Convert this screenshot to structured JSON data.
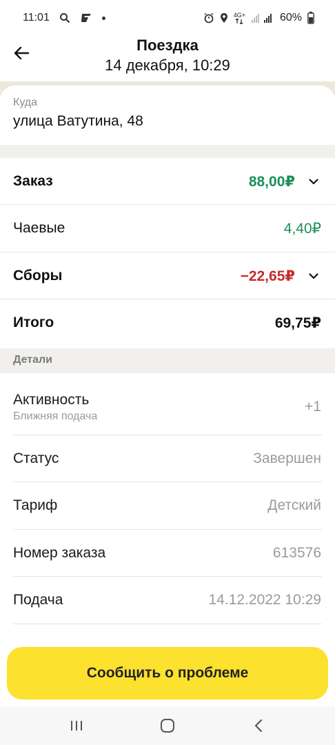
{
  "status_bar": {
    "time": "11:01",
    "battery": "60%",
    "network": "4G+",
    "icons": [
      "search-icon",
      "g-app-icon",
      "notification-dot",
      "alarm-icon",
      "location-icon",
      "network-icon",
      "signal-icon",
      "battery-icon"
    ]
  },
  "header": {
    "title": "Поездка",
    "subtitle": "14 декабря, 10:29",
    "back_icon": "arrow-left-icon"
  },
  "destination": {
    "label": "Куда",
    "value": "улица Ватутина, 48"
  },
  "summary": {
    "order": {
      "label": "Заказ",
      "value": "88,00₽",
      "color": "#1b8f5a"
    },
    "tips": {
      "label": "Чаевые",
      "value": "4,40₽",
      "color": "#1b8f5a"
    },
    "fees": {
      "label": "Сборы",
      "value": "−22,65₽",
      "color": "#c62b2b"
    },
    "total": {
      "label": "Итого",
      "value": "69,75₽"
    }
  },
  "details": {
    "section_title": "Детали",
    "activity": {
      "label": "Активность",
      "sublabel": "Ближняя подача",
      "value": "+1"
    },
    "status": {
      "label": "Статус",
      "value": "Завершен"
    },
    "tariff": {
      "label": "Тариф",
      "value": "Детский"
    },
    "order_number": {
      "label": "Номер заказа",
      "value": "613576"
    },
    "pickup": {
      "label": "Подача",
      "value": "14.12.2022 10:29"
    }
  },
  "actions": {
    "report_button": "Сообщить о проблеме",
    "button_color": "#fce12e"
  },
  "nav_bar": {
    "icons": [
      "recent-apps-icon",
      "home-icon",
      "back-icon"
    ]
  }
}
